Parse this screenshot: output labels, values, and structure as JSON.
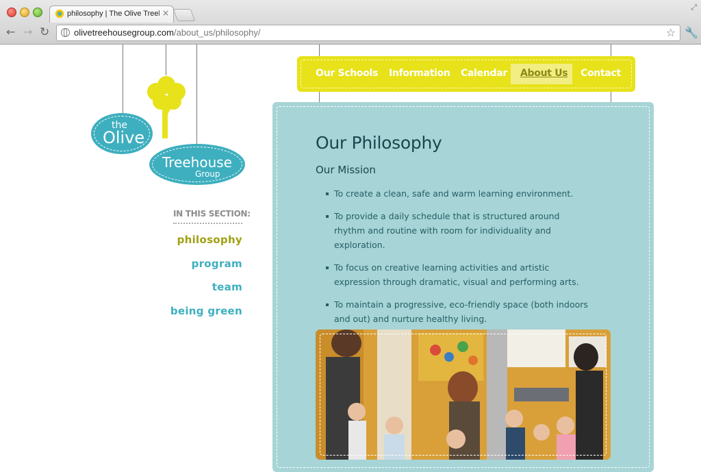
{
  "browser": {
    "tab_title": "philosophy | The Olive Treehouse Group",
    "tab_close": "×",
    "url_domain": "olivetreehousegroup.com",
    "url_path": "/about_us/philosophy/",
    "back": "←",
    "forward": "→",
    "reload": "↻",
    "star": "☆",
    "wrench": "🔧",
    "resize": "⤢"
  },
  "logo": {
    "the": "the",
    "olive": "Olive",
    "treehouse": "Treehouse",
    "group": "Group"
  },
  "nav": {
    "items": [
      {
        "label": "Our Schools"
      },
      {
        "label": "Information"
      },
      {
        "label": "Calendar"
      },
      {
        "label": "About Us",
        "active": true
      },
      {
        "label": "Contact"
      }
    ]
  },
  "section": {
    "label": "IN THIS SECTION:",
    "links": [
      {
        "label": "philosophy",
        "active": true
      },
      {
        "label": "program"
      },
      {
        "label": "team"
      },
      {
        "label": "being green"
      }
    ]
  },
  "main": {
    "title": "Our Philosophy",
    "subhead": "Our Mission",
    "bullets": [
      "To create a clean, safe and warm learning environment.",
      "To provide a daily schedule that is structured around rhythm and routine with room for individuality and exploration.",
      "To focus on creative learning activities and artistic expression through dramatic, visual and performing arts.",
      "To maintain a progressive, eco-friendly space (both indoors and out) and nurture healthy living."
    ]
  },
  "colors": {
    "brand_yellow": "#e7e21a",
    "brand_teal": "#3eafbf",
    "panel_bg": "#a7d4d6",
    "heading": "#18484e",
    "active_link": "#a1a013"
  }
}
